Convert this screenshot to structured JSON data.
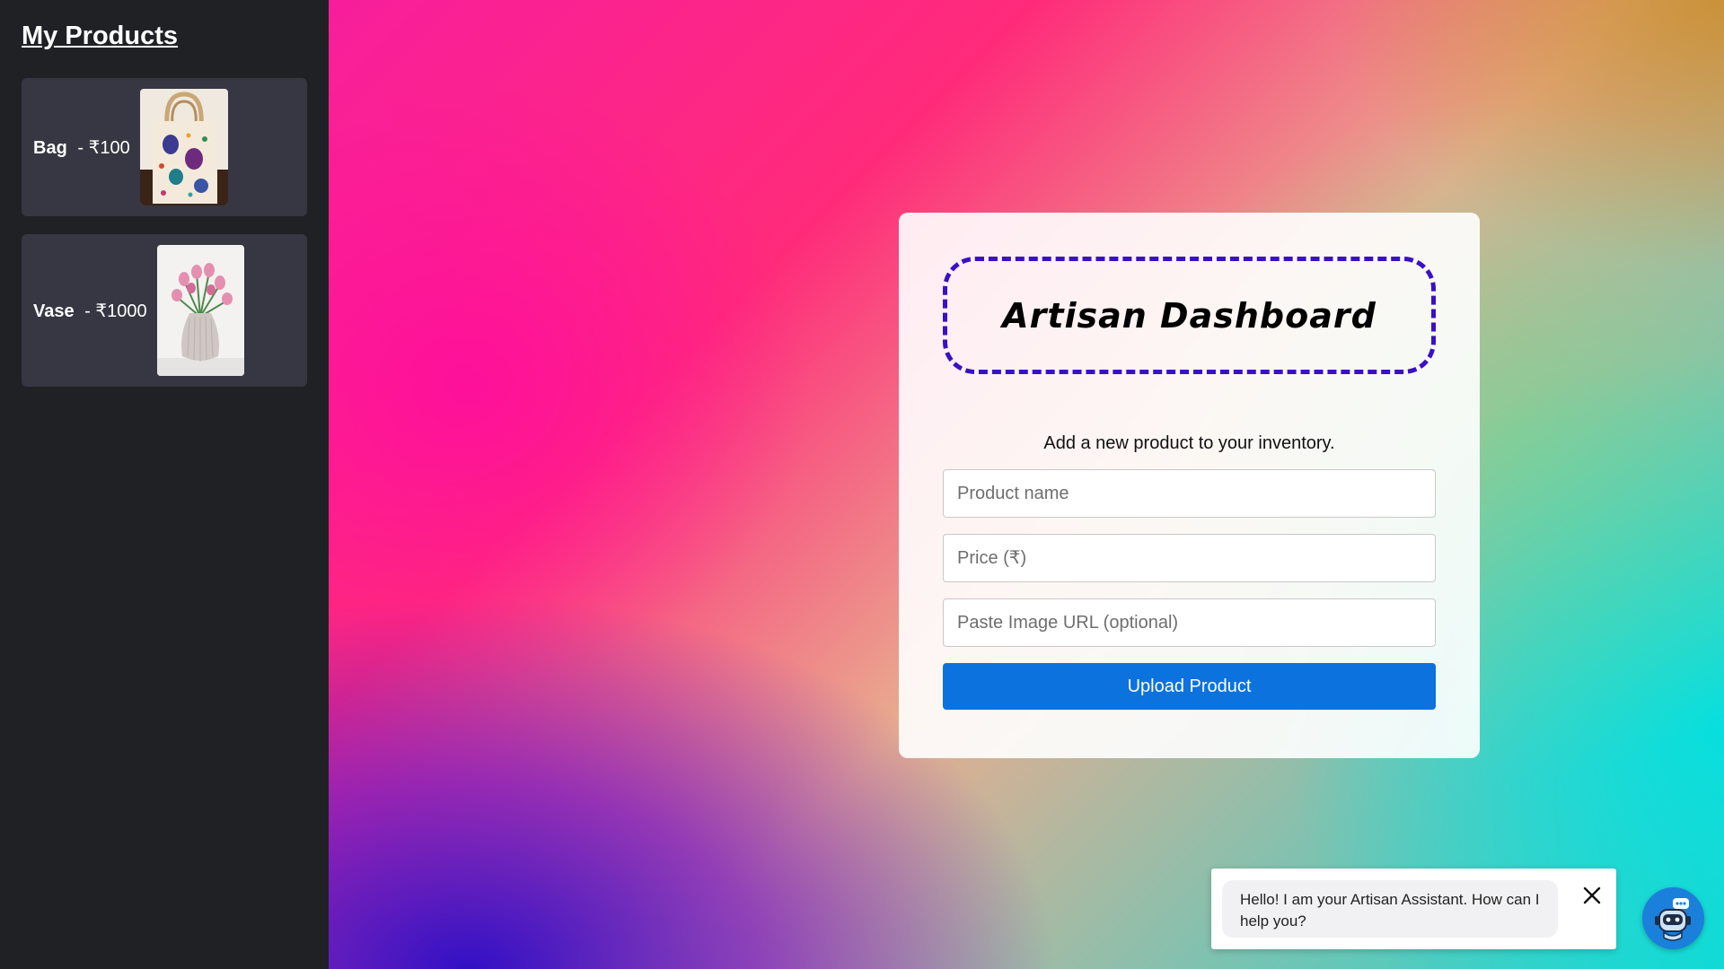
{
  "sidebar": {
    "title": "My Products",
    "products": [
      {
        "name": "Bag",
        "separator": "-",
        "price": "₹100",
        "image": "tote-bag-with-hot-air-balloons"
      },
      {
        "name": "Vase",
        "separator": "-",
        "price": "₹1000",
        "image": "white-vase-with-pink-tulips"
      }
    ]
  },
  "card": {
    "title": "Artisan Dashboard",
    "subtitle": "Add a new product to your inventory.",
    "fields": {
      "product_name": {
        "value": "",
        "placeholder": "Product name"
      },
      "price": {
        "value": "",
        "placeholder": "Price (₹)"
      },
      "image_url": {
        "value": "",
        "placeholder": "Paste Image URL (optional)"
      }
    },
    "upload_label": "Upload Product"
  },
  "chat": {
    "message": "Hello! I am your Artisan Assistant. How can I help you?",
    "close_icon": "close-icon",
    "fab_icon": "robot-icon"
  },
  "colors": {
    "sidebar_bg": "#202124",
    "product_card_bg": "#363742",
    "title_border": "#3a10c4",
    "button_bg": "#0c72de",
    "chat_fab_bg": "#1b7fdc"
  }
}
